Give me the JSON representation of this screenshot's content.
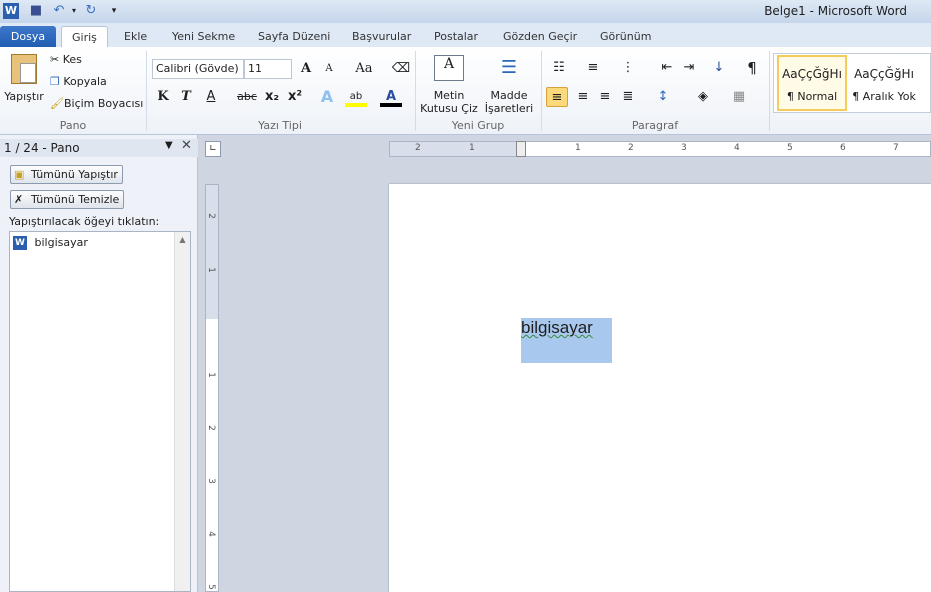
{
  "window": {
    "title": "Belge1  -  Microsoft Word"
  },
  "quick_access": [
    {
      "icon": "word-logo-icon"
    },
    {
      "icon": "save-icon"
    },
    {
      "icon": "undo-icon"
    },
    {
      "icon": "redo-icon"
    },
    {
      "icon": "customize-icon"
    }
  ],
  "tabs": [
    {
      "label": "Dosya"
    },
    {
      "label": "Giriş"
    },
    {
      "label": "Ekle"
    },
    {
      "label": "Yeni Sekme"
    },
    {
      "label": "Sayfa Düzeni"
    },
    {
      "label": "Başvurular"
    },
    {
      "label": "Postalar"
    },
    {
      "label": "Gözden Geçir"
    },
    {
      "label": "Görünüm"
    }
  ],
  "ribbon": {
    "pano": {
      "label": "Pano",
      "paste": "Yapıştır",
      "cut": "Kes",
      "copy": "Kopyala",
      "format_painter": "Biçim Boyacısı"
    },
    "font": {
      "label": "Yazı Tipi",
      "font_name": "Calibri (Gövde)",
      "font_size": "11",
      "bold": "K",
      "italic": "T",
      "underline": "A",
      "strike": "abc",
      "sub": "x₂",
      "sup": "x²",
      "grow": "A",
      "shrink": "A",
      "case": "Aa"
    },
    "yeni_grup": {
      "label": "Yeni Grup",
      "textbox": "Metin Kutusu Çiz",
      "bullets": "Madde İşaretleri"
    },
    "paragraph": {
      "label": "Paragraf",
      "pilcrow": "¶"
    },
    "styles": [
      {
        "preview": "AaÇçĞğHı",
        "name": "¶ Normal"
      },
      {
        "preview": "AaÇçĞğHı",
        "name": "¶ Aralık Yok"
      }
    ]
  },
  "clipboard_pane": {
    "title": "1 / 24 - Pano",
    "paste_all": "Tümünü Yapıştır",
    "clear_all": "Tümünü Temizle",
    "instruction": "Yapıştırılacak öğeyi tıklatın:",
    "items": [
      {
        "text": "bilgisayar"
      }
    ]
  },
  "ruler": {
    "h_labels": [
      "2",
      "1",
      "1",
      "2",
      "3",
      "4",
      "5",
      "6",
      "7"
    ],
    "v_labels": [
      "2",
      "1",
      "1",
      "2",
      "3",
      "4",
      "5"
    ]
  },
  "document": {
    "text": "bilgisayar"
  },
  "colors": {
    "accent": "#2b67b8",
    "selection": "#a8c8ee",
    "highlight": "#ffff00",
    "font_color": "#000000"
  }
}
